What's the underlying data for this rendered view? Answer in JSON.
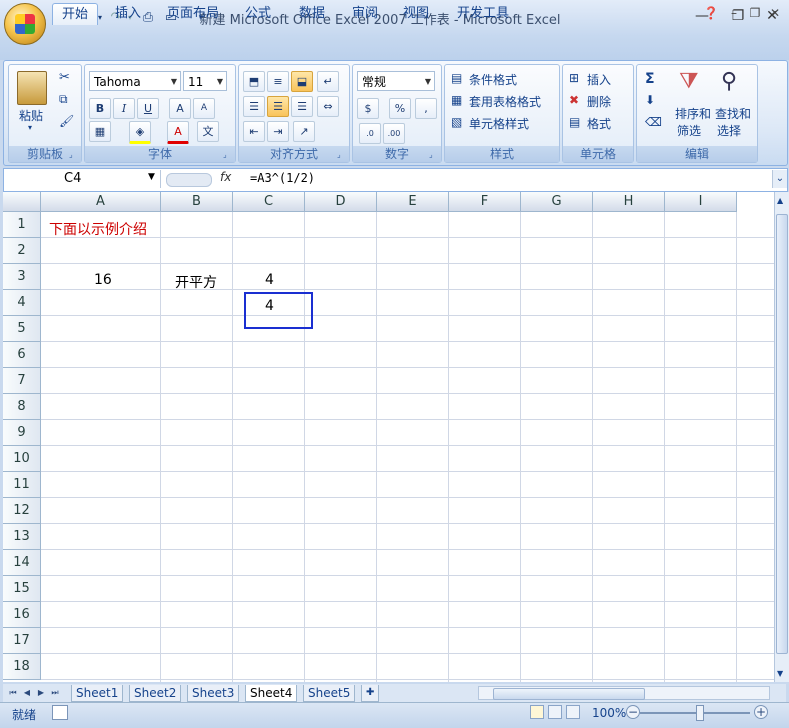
{
  "window": {
    "title": "新建 Microsoft Office Excel 2007 工作表 - Microsoft Excel",
    "minimize_icon": "minimize-icon",
    "maximize_icon": "restore-icon",
    "close_icon": "close-icon"
  },
  "quick_access": [
    "save-icon",
    "undo-icon",
    "redo-icon",
    "print-preview-icon",
    "new-icon"
  ],
  "tabs": [
    "开始",
    "插入",
    "页面布局",
    "公式",
    "数据",
    "审阅",
    "视图",
    "开发工具"
  ],
  "active_tab": "开始",
  "ribbon": {
    "clipboard": {
      "label": "剪贴板",
      "paste": "粘贴"
    },
    "font": {
      "label": "字体",
      "font_name": "Tahoma",
      "font_size": "11",
      "bold": "B",
      "italic": "I",
      "underline": "U",
      "grow": "A",
      "shrink": "A",
      "color_a": "A",
      "wen": "文"
    },
    "alignment": {
      "label": "对齐方式"
    },
    "number": {
      "label": "数字",
      "format": "常规",
      "percent": "%",
      "comma": ",",
      "inc": ".0",
      "dec": ".00"
    },
    "styles": {
      "label": "样式",
      "conditional": "条件格式",
      "table": "套用表格格式",
      "cell_styles": "单元格样式"
    },
    "cells": {
      "label": "单元格",
      "insert": "插入",
      "delete": "删除",
      "format": "格式"
    },
    "editing": {
      "label": "编辑",
      "sum": "Σ",
      "sort": "排序和",
      "sort2": "筛选",
      "find": "查找和",
      "find2": "选择"
    }
  },
  "formula_bar": {
    "name_box": "C4",
    "fx": "fx",
    "formula": "=A3^(1/2)"
  },
  "columns": [
    "A",
    "B",
    "C",
    "D",
    "E",
    "F",
    "G",
    "H",
    "I"
  ],
  "rows": [
    "1",
    "2",
    "3",
    "4",
    "5",
    "6",
    "7",
    "8",
    "9",
    "10",
    "11",
    "12",
    "13",
    "14",
    "15",
    "16",
    "17",
    "18"
  ],
  "cells": {
    "A1": "下面以示例介绍",
    "A3": "16",
    "B3": "开平方",
    "C3": "4",
    "C4": "4"
  },
  "colors": {
    "a1_text": "#cc0000",
    "selection": "#1a2fd1"
  },
  "sheets": [
    "Sheet1",
    "Sheet2",
    "Sheet3",
    "Sheet4",
    "Sheet5"
  ],
  "active_sheet": "Sheet4",
  "status": {
    "ready": "就绪",
    "zoom": "100%"
  }
}
